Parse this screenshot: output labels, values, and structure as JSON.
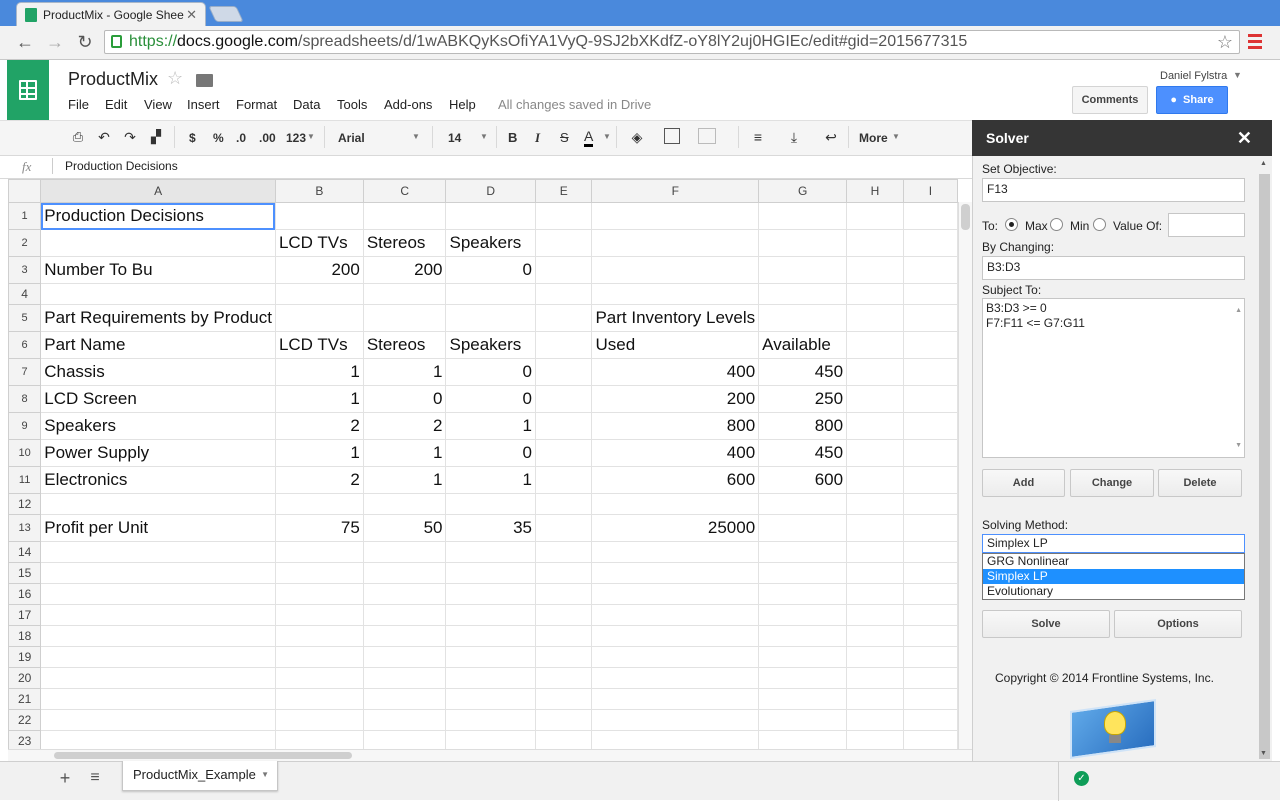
{
  "browser": {
    "tab_title": "ProductMix - Google Shee",
    "url_scheme": "https://",
    "url_host": "docs.google.com",
    "url_path": "/spreadsheets/d/1wABKQyKsOfiYA1VyQ-9SJ2bXKdfZ-oY8lY2uj0HGIEc/edit#gid=2015677315"
  },
  "doc": {
    "title": "ProductMix",
    "user": "Daniel Fylstra",
    "save_status": "All changes saved in Drive",
    "comments_label": "Comments",
    "share_label": "Share",
    "menus": [
      "File",
      "Edit",
      "View",
      "Insert",
      "Format",
      "Data",
      "Tools",
      "Add-ons",
      "Help"
    ]
  },
  "toolbar": {
    "currency": "$",
    "percent": "%",
    "dec_less": ".0",
    "dec_more": ".00",
    "format_more": "123",
    "font": "Arial",
    "size": "14",
    "bold": "B",
    "italic": "I",
    "strike": "S",
    "textcolor": "A",
    "more": "More"
  },
  "formula": {
    "fx": "fx",
    "content": "Production Decisions"
  },
  "grid": {
    "columns": [
      "A",
      "B",
      "C",
      "D",
      "E",
      "F",
      "G",
      "H",
      "I"
    ],
    "rows": [
      {
        "n": "1",
        "cells": [
          "Production Decisions",
          "",
          "",
          "",
          "",
          "",
          "",
          "",
          ""
        ]
      },
      {
        "n": "2",
        "cells": [
          "",
          "LCD TVs",
          "Stereos",
          "Speakers",
          "",
          "",
          "",
          "",
          ""
        ]
      },
      {
        "n": "3",
        "cells": [
          "Number To Bu",
          "200",
          "200",
          "0",
          "",
          "",
          "",
          "",
          ""
        ]
      },
      {
        "n": "4",
        "cells": [
          "",
          "",
          "",
          "",
          "",
          "",
          "",
          "",
          ""
        ]
      },
      {
        "n": "5",
        "cells": [
          "Part Requirements by Product",
          "",
          "",
          "",
          "",
          "Part Inventory Levels",
          "",
          "",
          ""
        ]
      },
      {
        "n": "6",
        "cells": [
          "Part Name",
          "LCD TVs",
          "Stereos",
          "Speakers",
          "",
          "Used",
          "Available",
          "",
          ""
        ]
      },
      {
        "n": "7",
        "cells": [
          "Chassis",
          "1",
          "1",
          "0",
          "",
          "400",
          "450",
          "",
          ""
        ]
      },
      {
        "n": "8",
        "cells": [
          "LCD Screen",
          "1",
          "0",
          "0",
          "",
          "200",
          "250",
          "",
          ""
        ]
      },
      {
        "n": "9",
        "cells": [
          "Speakers",
          "2",
          "2",
          "1",
          "",
          "800",
          "800",
          "",
          ""
        ]
      },
      {
        "n": "10",
        "cells": [
          "Power Supply",
          "1",
          "1",
          "0",
          "",
          "400",
          "450",
          "",
          ""
        ]
      },
      {
        "n": "11",
        "cells": [
          "Electronics",
          "2",
          "1",
          "1",
          "",
          "600",
          "600",
          "",
          ""
        ]
      },
      {
        "n": "12",
        "cells": [
          "",
          "",
          "",
          "",
          "",
          "",
          "",
          "",
          ""
        ]
      },
      {
        "n": "13",
        "cells": [
          "Profit per Unit",
          "75",
          "50",
          "35",
          "",
          "25000",
          "",
          "",
          ""
        ]
      },
      {
        "n": "14",
        "cells": [
          "",
          "",
          "",
          "",
          "",
          "",
          "",
          "",
          ""
        ]
      },
      {
        "n": "15",
        "cells": [
          "",
          "",
          "",
          "",
          "",
          "",
          "",
          "",
          ""
        ]
      },
      {
        "n": "16",
        "cells": [
          "",
          "",
          "",
          "",
          "",
          "",
          "",
          "",
          ""
        ]
      },
      {
        "n": "17",
        "cells": [
          "",
          "",
          "",
          "",
          "",
          "",
          "",
          "",
          ""
        ]
      },
      {
        "n": "18",
        "cells": [
          "",
          "",
          "",
          "",
          "",
          "",
          "",
          "",
          ""
        ]
      },
      {
        "n": "19",
        "cells": [
          "",
          "",
          "",
          "",
          "",
          "",
          "",
          "",
          ""
        ]
      },
      {
        "n": "20",
        "cells": [
          "",
          "",
          "",
          "",
          "",
          "",
          "",
          "",
          ""
        ]
      },
      {
        "n": "21",
        "cells": [
          "",
          "",
          "",
          "",
          "",
          "",
          "",
          "",
          ""
        ]
      },
      {
        "n": "22",
        "cells": [
          "",
          "",
          "",
          "",
          "",
          "",
          "",
          "",
          ""
        ]
      },
      {
        "n": "23",
        "cells": [
          "",
          "",
          "",
          "",
          "",
          "",
          "",
          "",
          ""
        ]
      }
    ]
  },
  "sheets": {
    "active": "ProductMix_Example"
  },
  "solver": {
    "title": "Solver",
    "set_objective_label": "Set Objective:",
    "objective": "F13",
    "to_label": "To:",
    "max_label": "Max",
    "min_label": "Min",
    "valueof_label": "Value Of:",
    "valueof": "",
    "by_changing_label": "By Changing:",
    "changing": "B3:D3",
    "subject_to_label": "Subject To:",
    "constraints": [
      "B3:D3 >= 0",
      "F7:F11 <= G7:G11"
    ],
    "add_label": "Add",
    "change_label": "Change",
    "delete_label": "Delete",
    "method_label": "Solving Method:",
    "method_selected": "Simplex LP",
    "methods": [
      "GRG Nonlinear",
      "Simplex LP",
      "Evolutionary"
    ],
    "solve_label": "Solve",
    "options_label": "Options",
    "copyright": "Copyright © 2014 Frontline Systems, Inc."
  }
}
